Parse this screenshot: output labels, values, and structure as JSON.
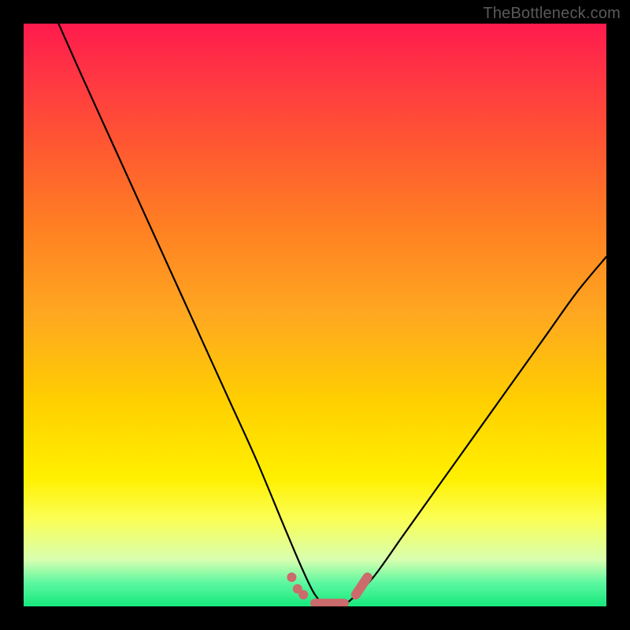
{
  "watermark": "TheBottleneck.com",
  "chart_data": {
    "type": "line",
    "title": "",
    "xlabel": "",
    "ylabel": "",
    "xlim": [
      0,
      100
    ],
    "ylim": [
      0,
      100
    ],
    "grid": false,
    "background": "traffic-light-gradient",
    "series": [
      {
        "name": "bottleneck-curve",
        "color": "#000000",
        "x": [
          6,
          10,
          15,
          20,
          25,
          30,
          35,
          40,
          45,
          48,
          50,
          52,
          54,
          56,
          60,
          65,
          70,
          75,
          80,
          85,
          90,
          95,
          100
        ],
        "y": [
          100,
          91,
          80,
          69,
          58,
          47,
          36,
          25,
          13,
          6,
          2,
          0,
          0,
          1,
          5,
          12,
          19,
          26,
          33,
          40,
          47,
          54,
          60
        ]
      }
    ],
    "markers": [
      {
        "name": "left-cluster",
        "color": "#cc6b6b",
        "shape": "circle",
        "points": [
          [
            46,
            5
          ],
          [
            47,
            3
          ],
          [
            48,
            2
          ]
        ]
      },
      {
        "name": "flat-cluster",
        "color": "#cc6b6b",
        "shape": "pill",
        "points": [
          [
            50,
            0.5
          ],
          [
            55,
            0.5
          ]
        ]
      },
      {
        "name": "right-cluster",
        "color": "#cc6b6b",
        "shape": "pill",
        "points": [
          [
            57,
            2
          ],
          [
            59,
            5
          ]
        ]
      }
    ]
  }
}
